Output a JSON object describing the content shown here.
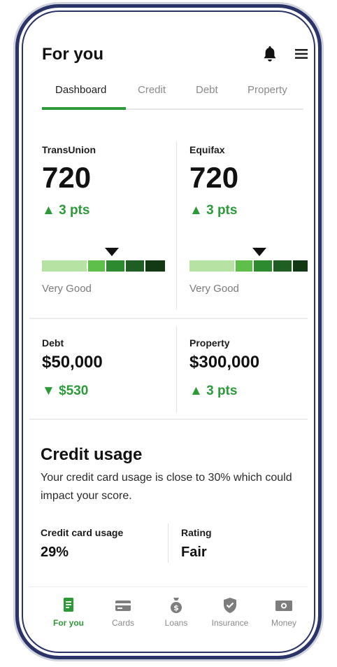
{
  "header": {
    "title": "For you"
  },
  "icons": {
    "bell": "bell-icon",
    "menu": "hamburger-menu-icon"
  },
  "tabs": [
    {
      "label": "Dashboard",
      "active": true
    },
    {
      "label": "Credit",
      "active": false
    },
    {
      "label": "Debt",
      "active": false
    },
    {
      "label": "Property",
      "active": false
    }
  ],
  "scores": [
    {
      "bureau": "TransUnion",
      "score": "720",
      "change": "3 pts",
      "direction": "up",
      "rating": "Very Good",
      "level_segment": 4
    },
    {
      "bureau": "Equifax",
      "score": "720",
      "change": "3 pts",
      "direction": "up",
      "rating": "Very Good",
      "level_segment": 4
    }
  ],
  "summary": [
    {
      "label": "Debt",
      "value": "$50,000",
      "change": "$530",
      "direction": "down"
    },
    {
      "label": "Property",
      "value": "$300,000",
      "change": "3 pts",
      "direction": "up"
    }
  ],
  "credit_usage": {
    "title": "Credit usage",
    "description": "Your credit card usage is close to 30% which could impact your score.",
    "stats": [
      {
        "label": "Credit card usage",
        "value": "29%"
      },
      {
        "label": "Rating",
        "value": "Fair"
      }
    ]
  },
  "nav": [
    {
      "label": "For you",
      "icon": "document-icon",
      "active": true
    },
    {
      "label": "Cards",
      "icon": "credit-card-icon",
      "active": false
    },
    {
      "label": "Loans",
      "icon": "money-bag-icon",
      "active": false
    },
    {
      "label": "Insurance",
      "icon": "shield-check-icon",
      "active": false
    },
    {
      "label": "Money",
      "icon": "cash-icon",
      "active": false
    }
  ],
  "colors": {
    "accent": "#2d9a3a",
    "frame": "#2b3468",
    "gauge": [
      "#b6e3a4",
      "#5ec04b",
      "#2e8a2e",
      "#1f5e22",
      "#123814"
    ]
  }
}
